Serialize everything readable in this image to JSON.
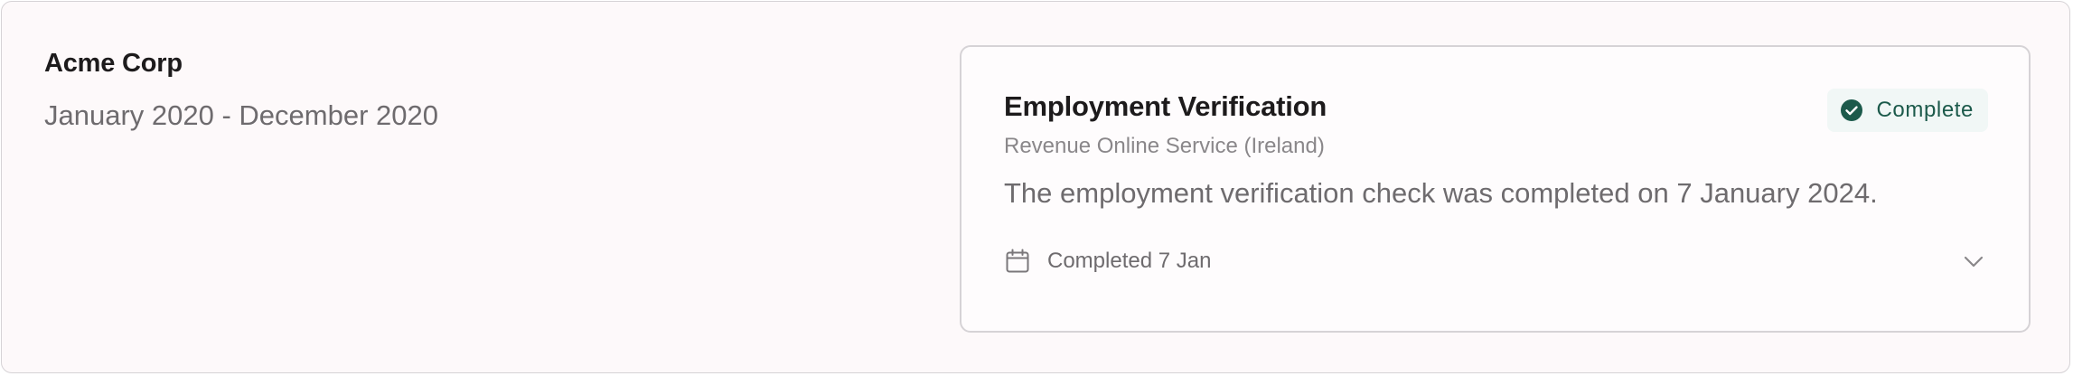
{
  "employment": {
    "company": "Acme Corp",
    "period": "January 2020 - December 2020"
  },
  "verification": {
    "title": "Employment Verification",
    "source": "Revenue Online Service (Ireland)",
    "description": "The employment verification check was completed on 7 January 2024.",
    "status": {
      "label": "Complete",
      "icon": "check-circle-icon",
      "color": "#1c5a4b",
      "background": "#f1f7f6"
    },
    "completed": {
      "icon": "calendar-icon",
      "label": "Completed 7 Jan"
    },
    "expand_icon": "chevron-down-icon"
  }
}
